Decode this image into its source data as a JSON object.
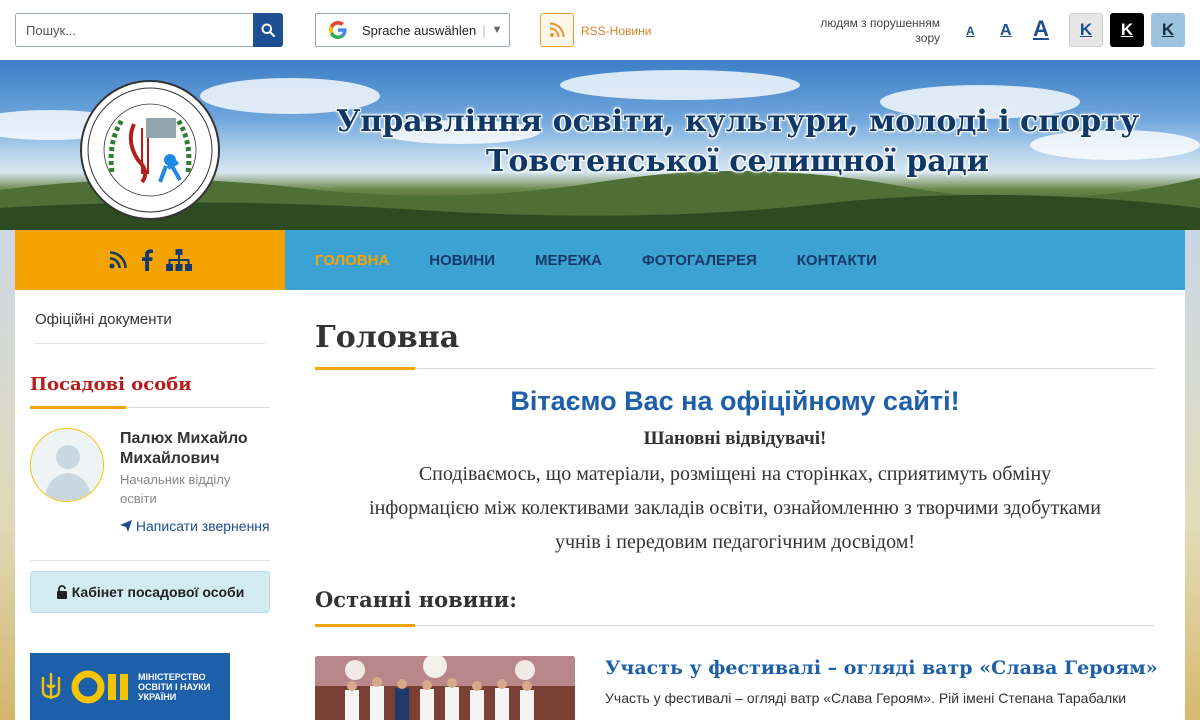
{
  "topbar": {
    "search_placeholder": "Пошук...",
    "language_label": "Sprache auswählen",
    "language_arrow": "▼",
    "rss_label": "RSS-Новини",
    "impaired_label": "людям з порушенням зору",
    "font_sizes": [
      "A",
      "A",
      "A"
    ],
    "contrast_labels": [
      "K",
      "K",
      "K"
    ]
  },
  "header": {
    "title_line1": "Управління освіти, культури, молоді і спорту",
    "title_line2": "Товстенської селищної ради"
  },
  "nav": {
    "icons": [
      "rss-icon",
      "facebook-icon",
      "sitemap-icon"
    ],
    "items": [
      {
        "label": "ГОЛОВНА",
        "active": true
      },
      {
        "label": "НОВИНИ",
        "active": false
      },
      {
        "label": "МЕРЕЖА",
        "active": false
      },
      {
        "label": "ФОТОГАЛЕРЕЯ",
        "active": false
      },
      {
        "label": "КОНТАКТИ",
        "active": false
      }
    ]
  },
  "sidebar": {
    "documents_label": "Офіційні документи",
    "officials_title": "Посадові особи",
    "person_name": "Палюх Михайло Михайлович",
    "person_role": "Начальник відділу освіти",
    "write_label": "Написати звернення",
    "cabinet_label": "Кабінет посадової особи",
    "mon_banner_text": "МІНІСТЕРСТВО ОСВІТИ І НАУКИ УКРАЇНИ"
  },
  "main": {
    "page_title": "Головна",
    "welcome": "Вітаємо Вас на офіційному сайті!",
    "dear_visitors": "Шановні відвідувачі!",
    "intro": "Сподіваємось, що матеріали, розміщені на сторінках, сприятимуть обміну інформацією між колективами закладів освіти, ознайомленню з творчими здобутками учнів і передовим педагогічним досвідом!",
    "latest_news_title": "Останні новини:",
    "news": [
      {
        "headline": "Участь у фестивалі – огляді ватр «Слава Героям»",
        "excerpt": "Участь у фестивалі – огляді ватр «Слава Героям». Рій імені Степана Тарабалки"
      }
    ]
  },
  "colors": {
    "accent": "#f4a300",
    "nav_blue": "#3ba2d4",
    "brand_blue": "#1d4e8f",
    "officials_red": "#b71c1c"
  }
}
